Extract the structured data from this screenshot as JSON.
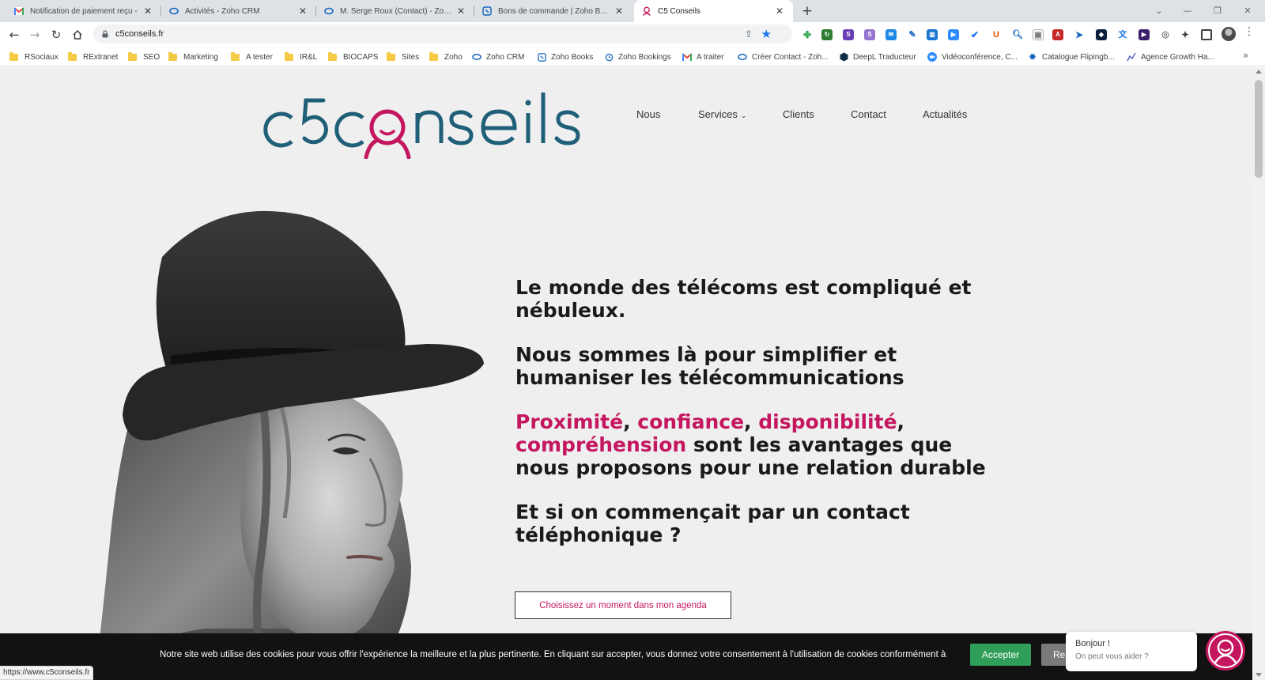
{
  "browser": {
    "tabs": [
      {
        "title": "Notification de paiement reçu - ",
        "active": false
      },
      {
        "title": "Activités - Zoho CRM",
        "active": false
      },
      {
        "title": "M. Serge Roux (Contact) - Zoho C",
        "active": false
      },
      {
        "title": "Bons de commande | Zoho Book",
        "active": false
      },
      {
        "title": "C5 Conseils",
        "active": true
      }
    ],
    "new_tab_icon": "+",
    "address": "c5conseils.fr",
    "bookmarks": [
      {
        "label": "RSociaux",
        "icon": "folder"
      },
      {
        "label": "RExtranet",
        "icon": "folder"
      },
      {
        "label": "SEO",
        "icon": "folder"
      },
      {
        "label": "Marketing",
        "icon": "folder"
      },
      {
        "label": "A tester",
        "icon": "folder"
      },
      {
        "label": "IR&L",
        "icon": "folder"
      },
      {
        "label": "BIOCAPS",
        "icon": "folder"
      },
      {
        "label": "Sites",
        "icon": "folder"
      },
      {
        "label": "Zoho",
        "icon": "folder"
      },
      {
        "label": "Zoho CRM",
        "icon": "zoho-crm"
      },
      {
        "label": "Zoho Books",
        "icon": "zoho-books"
      },
      {
        "label": "Zoho Bookings",
        "icon": "zoho-bookings"
      },
      {
        "label": "A traiter",
        "icon": "gmail"
      },
      {
        "label": "Créer Contact - Zoh...",
        "icon": "zoho-crm"
      },
      {
        "label": "DeepL Traducteur",
        "icon": "deepl"
      },
      {
        "label": "Vidéoconférence, C...",
        "icon": "zoom"
      },
      {
        "label": "Catalogue Flipingb...",
        "icon": "gear"
      },
      {
        "label": "Agence Growth Ha...",
        "icon": "growth"
      }
    ],
    "status_url": "https://www.c5conseils.fr"
  },
  "site": {
    "logo_text": "c5conseils",
    "nav": [
      "Nous",
      "Services",
      "Clients",
      "Contact",
      "Actualités"
    ],
    "hero": {
      "p1": "Le monde des télécoms est compliqué et nébuleux.",
      "p2": "Nous sommes là pour simplifier et humaniser les télécommunications",
      "p3_words": [
        "Proximité",
        ", ",
        "confiance",
        ", ",
        "disponibilité",
        ", ",
        "compréhension",
        " sont les avantages que nous proposons pour une relation durable"
      ],
      "p4": "Et si on commençait par un contact téléphonique ?"
    },
    "cta": "Choisissez un moment dans mon agenda"
  },
  "cookie": {
    "text": "Notre site web utilise des cookies pour vous offrir l'expérience la meilleure et la plus pertinente. En cliquant sur accepter, vous donnez votre consentement à l'utilisation de cookies conformément à",
    "accept": "Accepter",
    "reject": "Re"
  },
  "chat": {
    "greeting": "Bonjour !",
    "subtitle": "On peut vous aider ?"
  },
  "colors": {
    "brand_teal": "#1f5f78",
    "brand_pink": "#c4175f",
    "accept_green": "#2e9e58"
  }
}
